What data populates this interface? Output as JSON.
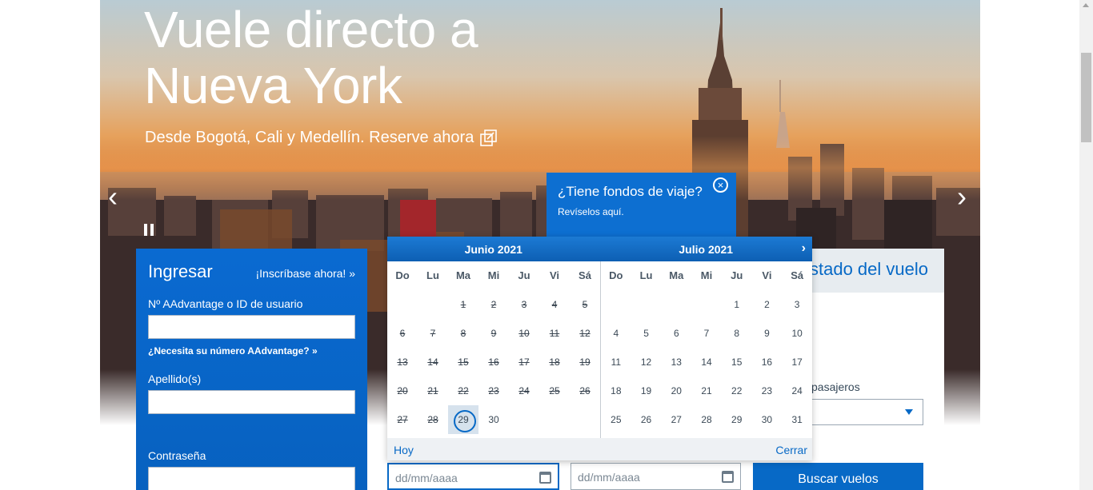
{
  "hero": {
    "title_line1": "Vuele directo a",
    "title_line2": "Nueva York",
    "subtitle": "Desde Bogotá, Cali y Medellín. Reserve ahora",
    "prev": "‹",
    "next": "›"
  },
  "promo": {
    "title": "¿Tiene fondos de viaje?",
    "subtitle": "Revíselos aquí."
  },
  "login": {
    "heading": "Ingresar",
    "enroll": "¡Inscríbase ahora! »",
    "user_label": "Nº AAdvantage o ID de usuario",
    "user_help": "¿Necesita su número AAdvantage? »",
    "lastname_label": "Apellido(s)",
    "password_label": "Contraseña"
  },
  "status_tab": {
    "label": "stado del vuelo"
  },
  "passengers": {
    "label": "pasajeros"
  },
  "datepicker": {
    "months": [
      {
        "title": "Junio 2021",
        "weekdays": [
          "Do",
          "Lu",
          "Ma",
          "Mi",
          "Ju",
          "Vi",
          "Sá"
        ],
        "weeks": [
          [
            "",
            "",
            "1",
            "2",
            "3",
            "4",
            "5"
          ],
          [
            "6",
            "7",
            "8",
            "9",
            "10",
            "11",
            "12"
          ],
          [
            "13",
            "14",
            "15",
            "16",
            "17",
            "18",
            "19"
          ],
          [
            "20",
            "21",
            "22",
            "23",
            "24",
            "25",
            "26"
          ],
          [
            "27",
            "28",
            "29",
            "30",
            "",
            "",
            ""
          ]
        ]
      },
      {
        "title": "Julio 2021",
        "weekdays": [
          "Do",
          "Lu",
          "Ma",
          "Mi",
          "Ju",
          "Vi",
          "Sá"
        ],
        "weeks": [
          [
            "",
            "",
            "",
            "",
            "1",
            "2",
            "3"
          ],
          [
            "4",
            "5",
            "6",
            "7",
            "8",
            "9",
            "10"
          ],
          [
            "11",
            "12",
            "13",
            "14",
            "15",
            "16",
            "17"
          ],
          [
            "18",
            "19",
            "20",
            "21",
            "22",
            "23",
            "24"
          ],
          [
            "25",
            "26",
            "27",
            "28",
            "29",
            "30",
            "31"
          ]
        ]
      }
    ],
    "today_label": "Hoy",
    "close_label": "Cerrar",
    "selected_day": "29",
    "past_days_june": 28,
    "next_arrow": "›"
  },
  "dates": {
    "depart_placeholder": "dd/mm/aaaa",
    "return_placeholder": "dd/mm/aaaa"
  },
  "search": {
    "button_label": "Buscar vuelos"
  },
  "colors": {
    "brand_blue": "#0769c6",
    "promo_blue": "#0d6fd1"
  }
}
